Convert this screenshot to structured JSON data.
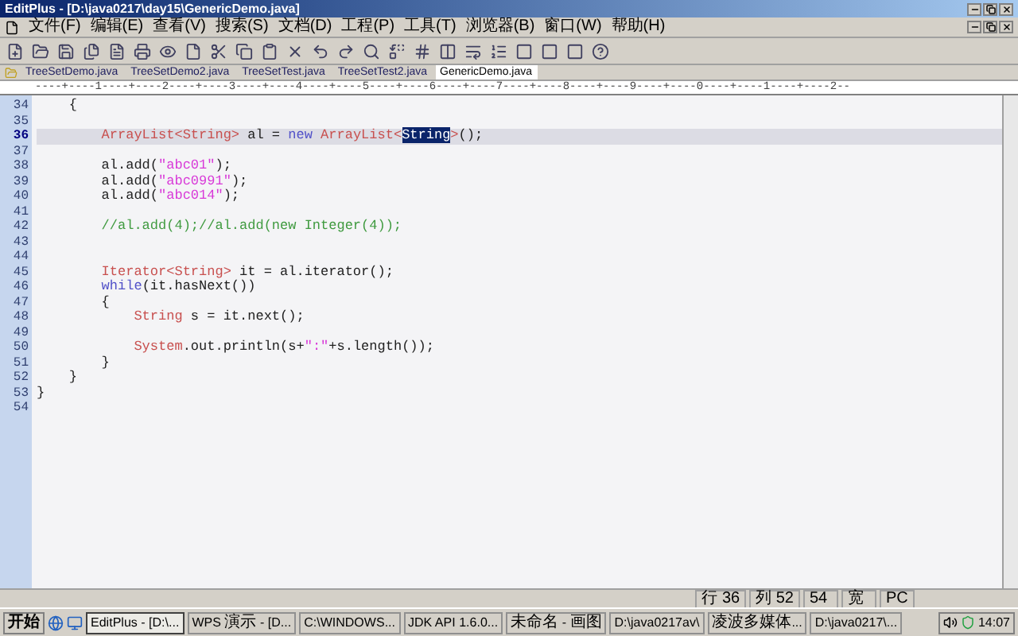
{
  "window": {
    "title": "EditPlus - [D:\\java0217\\day15\\GenericDemo.java]"
  },
  "menu": [
    "文件(F)",
    "编辑(E)",
    "查看(V)",
    "搜索(S)",
    "文档(D)",
    "工程(P)",
    "工具(T)",
    "浏览器(B)",
    "窗口(W)",
    "帮助(H)"
  ],
  "tabs": [
    {
      "label": "TreeSetDemo.java",
      "selected": false
    },
    {
      "label": "TreeSetDemo2.java",
      "selected": false
    },
    {
      "label": "TreeSetTest.java",
      "selected": false
    },
    {
      "label": "TreeSetTest2.java",
      "selected": false
    },
    {
      "label": "GenericDemo.java",
      "selected": true
    }
  ],
  "ruler": "----+----1----+----2----+----3----+----4----+----5----+----6----+----7----+----8----+----9----+----0----+----1----+----2--",
  "lines": [
    {
      "number": "34",
      "current": false,
      "tokens": [
        {
          "kind": "plain",
          "text": "    {"
        }
      ]
    },
    {
      "number": "35",
      "current": false
    },
    {
      "number": "36",
      "current": true,
      "tokens": [
        {
          "kind": "type",
          "text": "        ArrayList<String>"
        },
        {
          "kind": "plain",
          "text": " al = "
        },
        {
          "kind": "keyword",
          "text": "new"
        },
        {
          "kind": "type",
          "text": " ArrayList<"
        },
        {
          "kind": "selection",
          "text": "String"
        },
        {
          "kind": "type",
          "text": ">"
        },
        {
          "kind": "plain",
          "text": "();"
        }
      ]
    },
    {
      "number": "37",
      "current": false
    },
    {
      "number": "38",
      "current": false,
      "tokens": [
        {
          "kind": "plain",
          "text": "        al.add("
        },
        {
          "kind": "string",
          "text": "\"abc01\""
        },
        {
          "kind": "plain",
          "text": ");"
        }
      ]
    },
    {
      "number": "39",
      "current": false,
      "tokens": [
        {
          "kind": "plain",
          "text": "        al.add("
        },
        {
          "kind": "string",
          "text": "\"abc0991\""
        },
        {
          "kind": "plain",
          "text": ");"
        }
      ]
    },
    {
      "number": "40",
      "current": false,
      "tokens": [
        {
          "kind": "plain",
          "text": "        al.add("
        },
        {
          "kind": "string",
          "text": "\"abc014\""
        },
        {
          "kind": "plain",
          "text": ");"
        }
      ]
    },
    {
      "number": "41",
      "current": false
    },
    {
      "number": "42",
      "current": false,
      "tokens": [
        {
          "kind": "comment",
          "text": "        //al.add(4);//al.add(new Integer(4));"
        }
      ]
    },
    {
      "number": "43",
      "current": false
    },
    {
      "number": "44",
      "current": false
    },
    {
      "number": "45",
      "current": false,
      "tokens": [
        {
          "kind": "type",
          "text": "        Iterator<String>"
        },
        {
          "kind": "plain",
          "text": " it = al.iterator();"
        }
      ]
    },
    {
      "number": "46",
      "current": false,
      "tokens": [
        {
          "kind": "keyword",
          "text": "        while"
        },
        {
          "kind": "plain",
          "text": "(it.hasNext())"
        }
      ]
    },
    {
      "number": "47",
      "current": false,
      "tokens": [
        {
          "kind": "plain",
          "text": "        {"
        }
      ]
    },
    {
      "number": "48",
      "current": false,
      "tokens": [
        {
          "kind": "type",
          "text": "            String"
        },
        {
          "kind": "plain",
          "text": " s = it.next();"
        }
      ]
    },
    {
      "number": "49",
      "current": false
    },
    {
      "number": "50",
      "current": false,
      "tokens": [
        {
          "kind": "type",
          "text": "            System"
        },
        {
          "kind": "plain",
          "text": ".out.println(s+"
        },
        {
          "kind": "string",
          "text": "\":\""
        },
        {
          "kind": "plain",
          "text": "+s.length());"
        }
      ]
    },
    {
      "number": "51",
      "current": false,
      "tokens": [
        {
          "kind": "plain",
          "text": "        }"
        }
      ]
    },
    {
      "number": "52",
      "current": false,
      "tokens": [
        {
          "kind": "plain",
          "text": "    }"
        }
      ]
    },
    {
      "number": "53",
      "current": false,
      "tokens": [
        {
          "kind": "plain",
          "text": "}"
        }
      ]
    },
    {
      "number": "54",
      "current": false
    }
  ],
  "status_bar": [
    "行 36",
    "列 52",
    "54",
    "宽",
    "PC"
  ],
  "taskbar": {
    "start": "开始",
    "buttons": [
      {
        "label": "EditPlus - [D:\\...",
        "selected": true
      },
      {
        "label": "WPS 演示 - [D...",
        "selected": false
      },
      {
        "label": "C:\\WINDOWS...",
        "selected": false
      },
      {
        "label": "JDK API 1.6.0...",
        "selected": false
      },
      {
        "label": "未命名 - 画图",
        "selected": false
      },
      {
        "label": "D:\\java0217av\\",
        "selected": false
      },
      {
        "label": "凌波多媒体...",
        "selected": false
      },
      {
        "label": "D:\\java0217\\...",
        "selected": false
      }
    ],
    "clock": "14:07"
  }
}
